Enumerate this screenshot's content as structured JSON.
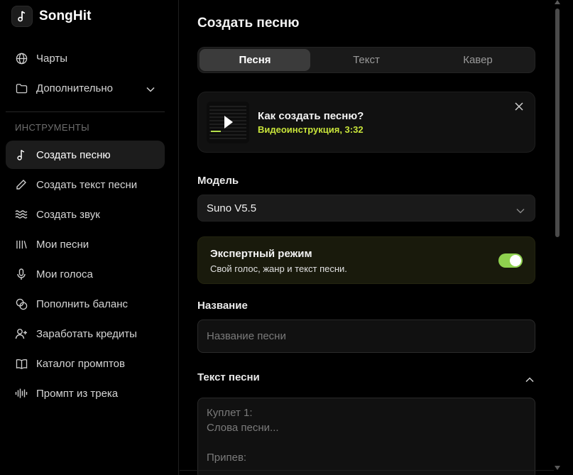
{
  "brand": {
    "name": "SongHit",
    "logo_icon": "music-note-icon"
  },
  "sidebar": {
    "top_items": [
      {
        "label": "Чарты",
        "icon": "globe-icon"
      },
      {
        "label": "Дополнительно",
        "icon": "folder-icon"
      }
    ],
    "section_label": "ИНСТРУМЕНТЫ",
    "tools": [
      {
        "label": "Создать песню",
        "icon": "music-note-icon",
        "active": true
      },
      {
        "label": "Создать текст песни",
        "icon": "pencil-icon"
      },
      {
        "label": "Создать звук",
        "icon": "waves-icon"
      },
      {
        "label": "Мои песни",
        "icon": "library-icon"
      },
      {
        "label": "Мои голоса",
        "icon": "microphone-icon"
      },
      {
        "label": "Пополнить баланс",
        "icon": "coins-icon"
      },
      {
        "label": "Заработать кредиты",
        "icon": "user-plus-icon"
      },
      {
        "label": "Каталог промптов",
        "icon": "book-icon"
      },
      {
        "label": "Промпт из трека",
        "icon": "audio-lines-icon"
      }
    ]
  },
  "main": {
    "title": "Создать песню",
    "tabs": [
      {
        "label": "Песня",
        "active": true
      },
      {
        "label": "Текст",
        "active": false
      },
      {
        "label": "Кавер",
        "active": false
      }
    ],
    "video": {
      "title": "Как создать песню?",
      "subtitle": "Видеоинструкция, 3:32"
    },
    "model": {
      "label": "Модель",
      "value": "Suno V5.5"
    },
    "expert": {
      "title": "Экспертный режим",
      "subtitle": "Свой голос, жанр и текст песни.",
      "enabled": true
    },
    "name_field": {
      "label": "Название",
      "placeholder": "Название песни"
    },
    "lyrics_field": {
      "label": "Текст песни",
      "placeholder": "Куплет 1:\nСлова песни...\n\nПрипев:"
    }
  },
  "colors": {
    "accent": "#c8e43a",
    "toggle_on": "#8fd14f",
    "background": "#000000"
  }
}
